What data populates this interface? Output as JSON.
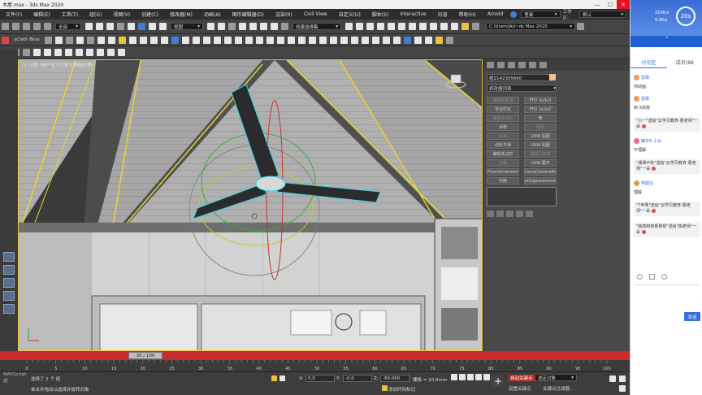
{
  "window": {
    "title": "木屋.max - 3ds Max 2020"
  },
  "menubar": {
    "items": [
      "文件(F)",
      "编辑(E)",
      "工具(T)",
      "组(G)",
      "视图(V)",
      "创建(C)",
      "修改器(M)",
      "动画(A)",
      "图形编辑器(D)",
      "渲染(R)",
      "Civil View",
      "自定义(U)",
      "脚本(S)",
      "Interactive",
      "内容",
      "帮助(H)",
      "Arnold"
    ],
    "login_label": "登录",
    "workspace_label": "工作区:",
    "workspace_value": "默认"
  },
  "toolbar1": {
    "filter_value": "全部",
    "viewcoord_value": "视图",
    "selection_set_value": "创建选择集",
    "path_value": "C:\\Users\\Ad~ds Max 2020"
  },
  "toolbar2": {
    "plugin_label": "yCloth Brus"
  },
  "viewport": {
    "label": "[+] [顶] [用户定义] [默认明暗处理]"
  },
  "command_panel": {
    "object_name": "组2142355660",
    "modifier_list_label": "修改器列表",
    "buttons": [
      {
        "label": "编辑样条线",
        "dim": true
      },
      {
        "label": "FFD 3x3x3",
        "dim": false
      },
      {
        "label": "专业优化",
        "dim": false
      },
      {
        "label": "FFD 2x2x2",
        "dim": false
      },
      {
        "label": "编辑多边形",
        "dim": true
      },
      {
        "label": "壳",
        "dim": false
      },
      {
        "label": "对称",
        "dim": false
      },
      {
        "label": "挤出",
        "dim": true
      },
      {
        "label": "车削",
        "dim": true
      },
      {
        "label": "UVW 贴图",
        "dim": false
      },
      {
        "label": "涡轮平滑",
        "dim": false
      },
      {
        "label": "UVW 贴图",
        "dim": false
      },
      {
        "label": "编辑多边形",
        "dim": false
      },
      {
        "label": "编辑几何体",
        "dim": true
      },
      {
        "label": "扫描",
        "dim": true
      },
      {
        "label": "UVW 展开",
        "dim": false
      },
      {
        "label": "FloorGenerator",
        "dim": false
      },
      {
        "label": "CoronaCameraMod",
        "dim": false
      },
      {
        "label": "切换",
        "dim": false
      },
      {
        "label": "VRayDisplacementMod",
        "dim": false
      }
    ]
  },
  "timeline": {
    "frame_display": "20 / 100",
    "ticks": [
      "0",
      "5",
      "10",
      "15",
      "20",
      "25",
      "30",
      "35",
      "40",
      "45",
      "50",
      "55",
      "60",
      "65",
      "70",
      "75",
      "80",
      "85",
      "90",
      "95",
      "100"
    ]
  },
  "statusbar": {
    "selection_text": "选择了 1 个 组",
    "hint_text": "单击并拖动以选择并旋转对象",
    "script_label": "MAXScript 迷",
    "x_label": "X:",
    "x_value": "0.0",
    "y_label": "Y:",
    "y_value": "-0.0",
    "z_label": "Z:",
    "z_value": "-89.000",
    "grid_label": "栅格 = 10.0mm",
    "add_time_tag": "添加时间标记",
    "autokey_label": "自动关键点",
    "setkey_label": "设置关键点",
    "selected_object": "选定对象",
    "keyfilter_label": "关键点过滤器..."
  },
  "chat": {
    "timer": "20s",
    "speed_up": "216K/s",
    "speed_down": "6.9K/s",
    "tab_discussion": "讨论区",
    "tab_members": "成员(88",
    "messages": [
      {
        "user": "雷霖",
        "text": "你动画",
        "bubble": false
      },
      {
        "user": "雷霖",
        "text": "用 X双挑",
        "bubble": false
      },
      {
        "user": "",
        "text": "\"六一\"送给\"云学贝教育-曹老师\"一朵",
        "bubble": true
      },
      {
        "user": "魔羊R 小云",
        "text": "不理解",
        "bubble": false
      },
      {
        "user": "",
        "text": "\"湘潭不秋\"送给\"云学贝教育-曹老师\"一朵",
        "bubble": true
      },
      {
        "user": "林韶征",
        "text": "理解",
        "bubble": false
      },
      {
        "user": "",
        "text": "\"7苹果\"送给\"云学贝教育-曹老师\"一朵",
        "bubble": true
      },
      {
        "user": "",
        "text": "\"我感到效果惠现\"送给\"陈老师\"一朵",
        "bubble": true
      }
    ],
    "send_label": "发送"
  }
}
